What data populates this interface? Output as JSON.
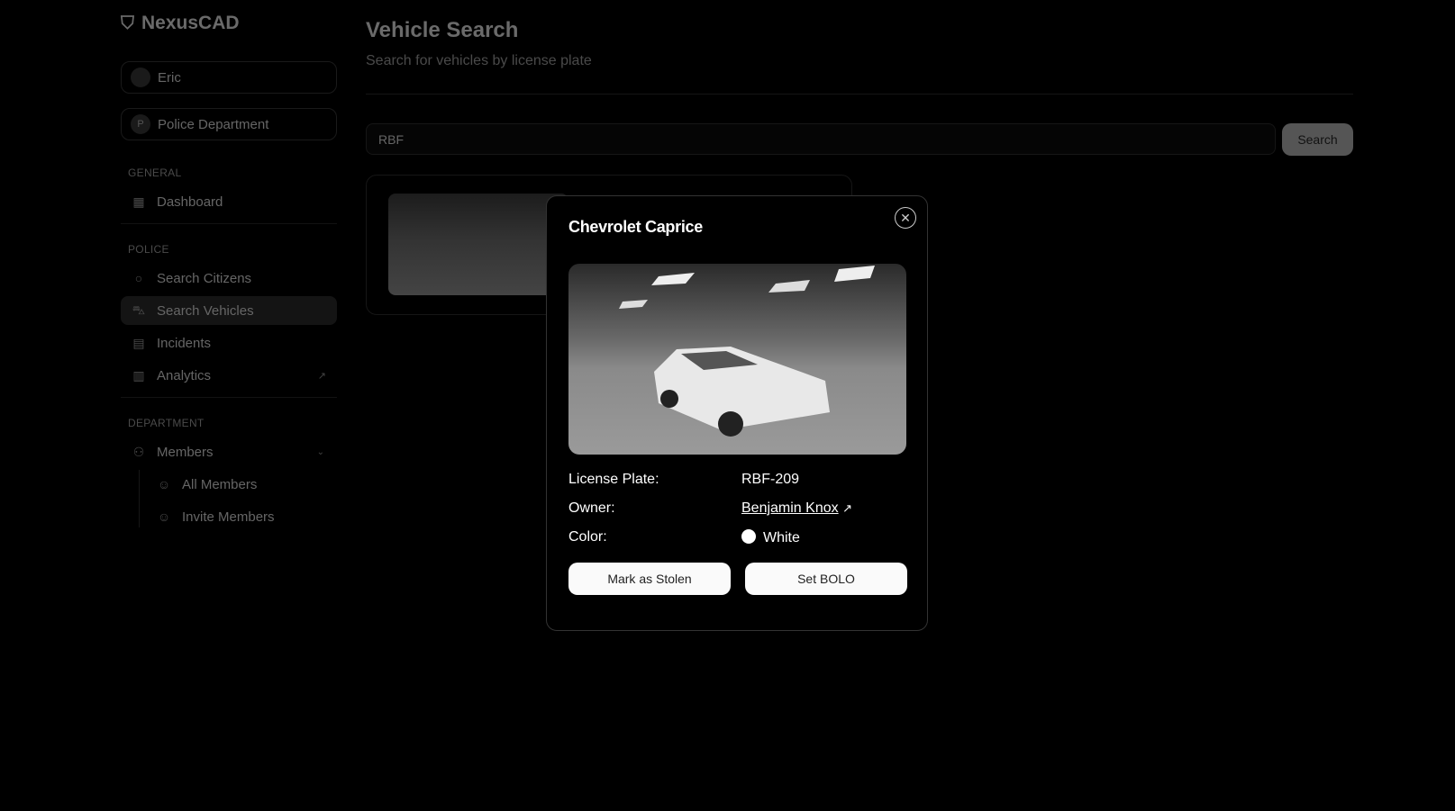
{
  "app": {
    "name": "NexusCAD"
  },
  "user": {
    "name": "Eric"
  },
  "department": {
    "initial": "P",
    "name": "Police Department"
  },
  "sidebar": {
    "general_label": "GENERAL",
    "police_label": "POLICE",
    "department_label": "DEPARTMENT",
    "items": [
      {
        "label": "Dashboard",
        "icon": "grid-icon"
      },
      {
        "label": "Search Citizens",
        "icon": "search-icon"
      },
      {
        "label": "Search Vehicles",
        "icon": "car-icon",
        "active": true
      },
      {
        "label": "Incidents",
        "icon": "clipboard-icon"
      },
      {
        "label": "Analytics",
        "icon": "bar-chart-icon"
      },
      {
        "label": "Members",
        "icon": "users-icon"
      },
      {
        "label": "All Members",
        "icon": "user-icon"
      },
      {
        "label": "Invite Members",
        "icon": "user-plus-icon"
      }
    ]
  },
  "page": {
    "title": "Vehicle Search",
    "subtitle": "Search for vehicles by license plate"
  },
  "search": {
    "value": "RBF",
    "button": "Search"
  },
  "modal": {
    "title": "Chevrolet Caprice",
    "plate_label": "License Plate:",
    "plate": "RBF-209",
    "owner_label": "Owner:",
    "owner": "Benjamin Knox",
    "color_label": "Color:",
    "color": "White",
    "color_hex": "#ffffff",
    "stolen_button": "Mark as Stolen",
    "bolo_button": "Set BOLO"
  }
}
